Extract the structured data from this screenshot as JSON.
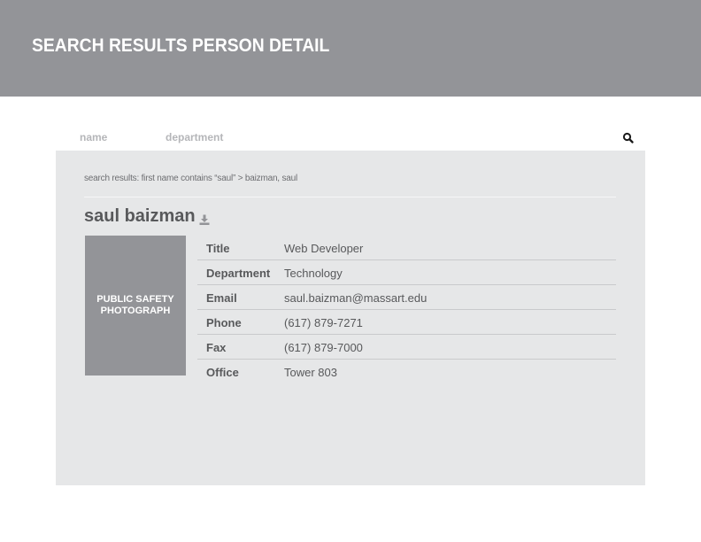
{
  "header": {
    "title": "SEARCH RESULTS PERSON DETAIL"
  },
  "tabs": [
    {
      "label": "name"
    },
    {
      "label": "department"
    }
  ],
  "search": {
    "icon": "search-icon"
  },
  "breadcrumb": "search results: first name contains “saul” > baizman, saul",
  "person": {
    "name": "saul baizman",
    "download_icon": "download-icon",
    "photo_label_line1": "PUBLIC SAFETY",
    "photo_label_line2": "PHOTOGRAPH"
  },
  "details": [
    {
      "label": "Title",
      "value": "Web Developer"
    },
    {
      "label": "Department",
      "value": "Technology"
    },
    {
      "label": "Email",
      "value": "saul.baizman@massart.edu"
    },
    {
      "label": "Phone",
      "value": "(617) 879-7271"
    },
    {
      "label": "Fax",
      "value": "(617) 879-7000"
    },
    {
      "label": "Office",
      "value": "Tower 803"
    }
  ],
  "colors": {
    "header_bg": "#939498",
    "panel_bg": "#e6e7e8",
    "text": "#58595b",
    "tab_text": "#b5b6b9"
  }
}
